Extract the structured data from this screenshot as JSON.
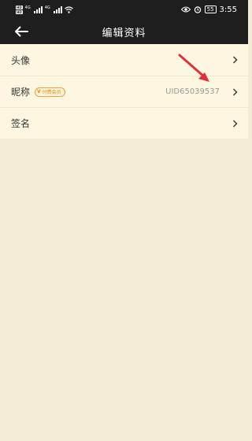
{
  "status_bar": {
    "sim1": "HD",
    "sim2": "HD",
    "signal_tag_1": "4G",
    "signal_tag_2": "4G",
    "battery": "55",
    "time": "3:55"
  },
  "header": {
    "title": "编辑资料"
  },
  "profile": {
    "avatar_label": "头像",
    "nickname_label": "昵称",
    "member_badge": "付费会员",
    "member_badge_icon": "V",
    "uid": "UID65039537",
    "signature_label": "签名"
  },
  "colors": {
    "header_bg": "#1e1e1e",
    "list_bg": "#fdf7e2",
    "page_bg": "#f3ecd5",
    "badge": "#e18b1c",
    "annotation_arrow": "#e0313a"
  }
}
